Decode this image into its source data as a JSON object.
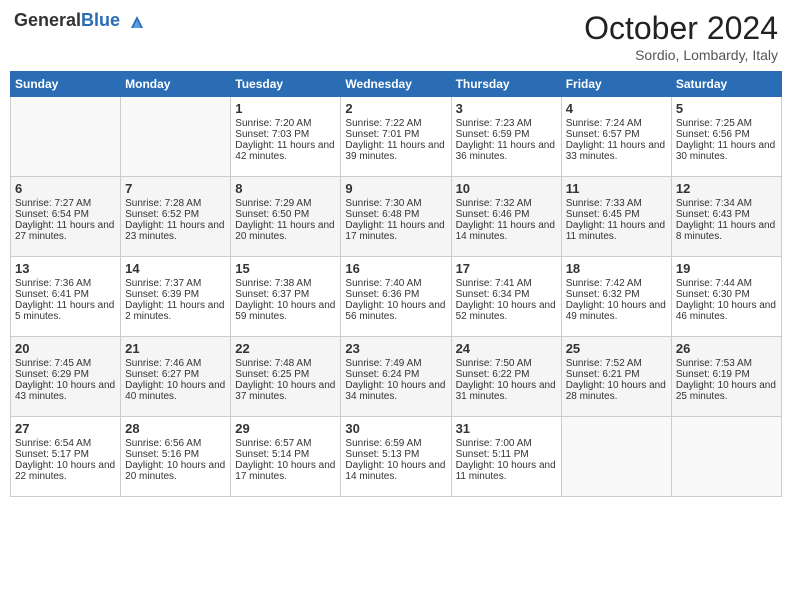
{
  "header": {
    "logo_general": "General",
    "logo_blue": "Blue",
    "month": "October 2024",
    "location": "Sordio, Lombardy, Italy"
  },
  "days_of_week": [
    "Sunday",
    "Monday",
    "Tuesday",
    "Wednesday",
    "Thursday",
    "Friday",
    "Saturday"
  ],
  "weeks": [
    [
      {
        "day": "",
        "sunrise": "",
        "sunset": "",
        "daylight": ""
      },
      {
        "day": "",
        "sunrise": "",
        "sunset": "",
        "daylight": ""
      },
      {
        "day": "1",
        "sunrise": "Sunrise: 7:20 AM",
        "sunset": "Sunset: 7:03 PM",
        "daylight": "Daylight: 11 hours and 42 minutes."
      },
      {
        "day": "2",
        "sunrise": "Sunrise: 7:22 AM",
        "sunset": "Sunset: 7:01 PM",
        "daylight": "Daylight: 11 hours and 39 minutes."
      },
      {
        "day": "3",
        "sunrise": "Sunrise: 7:23 AM",
        "sunset": "Sunset: 6:59 PM",
        "daylight": "Daylight: 11 hours and 36 minutes."
      },
      {
        "day": "4",
        "sunrise": "Sunrise: 7:24 AM",
        "sunset": "Sunset: 6:57 PM",
        "daylight": "Daylight: 11 hours and 33 minutes."
      },
      {
        "day": "5",
        "sunrise": "Sunrise: 7:25 AM",
        "sunset": "Sunset: 6:56 PM",
        "daylight": "Daylight: 11 hours and 30 minutes."
      }
    ],
    [
      {
        "day": "6",
        "sunrise": "Sunrise: 7:27 AM",
        "sunset": "Sunset: 6:54 PM",
        "daylight": "Daylight: 11 hours and 27 minutes."
      },
      {
        "day": "7",
        "sunrise": "Sunrise: 7:28 AM",
        "sunset": "Sunset: 6:52 PM",
        "daylight": "Daylight: 11 hours and 23 minutes."
      },
      {
        "day": "8",
        "sunrise": "Sunrise: 7:29 AM",
        "sunset": "Sunset: 6:50 PM",
        "daylight": "Daylight: 11 hours and 20 minutes."
      },
      {
        "day": "9",
        "sunrise": "Sunrise: 7:30 AM",
        "sunset": "Sunset: 6:48 PM",
        "daylight": "Daylight: 11 hours and 17 minutes."
      },
      {
        "day": "10",
        "sunrise": "Sunrise: 7:32 AM",
        "sunset": "Sunset: 6:46 PM",
        "daylight": "Daylight: 11 hours and 14 minutes."
      },
      {
        "day": "11",
        "sunrise": "Sunrise: 7:33 AM",
        "sunset": "Sunset: 6:45 PM",
        "daylight": "Daylight: 11 hours and 11 minutes."
      },
      {
        "day": "12",
        "sunrise": "Sunrise: 7:34 AM",
        "sunset": "Sunset: 6:43 PM",
        "daylight": "Daylight: 11 hours and 8 minutes."
      }
    ],
    [
      {
        "day": "13",
        "sunrise": "Sunrise: 7:36 AM",
        "sunset": "Sunset: 6:41 PM",
        "daylight": "Daylight: 11 hours and 5 minutes."
      },
      {
        "day": "14",
        "sunrise": "Sunrise: 7:37 AM",
        "sunset": "Sunset: 6:39 PM",
        "daylight": "Daylight: 11 hours and 2 minutes."
      },
      {
        "day": "15",
        "sunrise": "Sunrise: 7:38 AM",
        "sunset": "Sunset: 6:37 PM",
        "daylight": "Daylight: 10 hours and 59 minutes."
      },
      {
        "day": "16",
        "sunrise": "Sunrise: 7:40 AM",
        "sunset": "Sunset: 6:36 PM",
        "daylight": "Daylight: 10 hours and 56 minutes."
      },
      {
        "day": "17",
        "sunrise": "Sunrise: 7:41 AM",
        "sunset": "Sunset: 6:34 PM",
        "daylight": "Daylight: 10 hours and 52 minutes."
      },
      {
        "day": "18",
        "sunrise": "Sunrise: 7:42 AM",
        "sunset": "Sunset: 6:32 PM",
        "daylight": "Daylight: 10 hours and 49 minutes."
      },
      {
        "day": "19",
        "sunrise": "Sunrise: 7:44 AM",
        "sunset": "Sunset: 6:30 PM",
        "daylight": "Daylight: 10 hours and 46 minutes."
      }
    ],
    [
      {
        "day": "20",
        "sunrise": "Sunrise: 7:45 AM",
        "sunset": "Sunset: 6:29 PM",
        "daylight": "Daylight: 10 hours and 43 minutes."
      },
      {
        "day": "21",
        "sunrise": "Sunrise: 7:46 AM",
        "sunset": "Sunset: 6:27 PM",
        "daylight": "Daylight: 10 hours and 40 minutes."
      },
      {
        "day": "22",
        "sunrise": "Sunrise: 7:48 AM",
        "sunset": "Sunset: 6:25 PM",
        "daylight": "Daylight: 10 hours and 37 minutes."
      },
      {
        "day": "23",
        "sunrise": "Sunrise: 7:49 AM",
        "sunset": "Sunset: 6:24 PM",
        "daylight": "Daylight: 10 hours and 34 minutes."
      },
      {
        "day": "24",
        "sunrise": "Sunrise: 7:50 AM",
        "sunset": "Sunset: 6:22 PM",
        "daylight": "Daylight: 10 hours and 31 minutes."
      },
      {
        "day": "25",
        "sunrise": "Sunrise: 7:52 AM",
        "sunset": "Sunset: 6:21 PM",
        "daylight": "Daylight: 10 hours and 28 minutes."
      },
      {
        "day": "26",
        "sunrise": "Sunrise: 7:53 AM",
        "sunset": "Sunset: 6:19 PM",
        "daylight": "Daylight: 10 hours and 25 minutes."
      }
    ],
    [
      {
        "day": "27",
        "sunrise": "Sunrise: 6:54 AM",
        "sunset": "Sunset: 5:17 PM",
        "daylight": "Daylight: 10 hours and 22 minutes."
      },
      {
        "day": "28",
        "sunrise": "Sunrise: 6:56 AM",
        "sunset": "Sunset: 5:16 PM",
        "daylight": "Daylight: 10 hours and 20 minutes."
      },
      {
        "day": "29",
        "sunrise": "Sunrise: 6:57 AM",
        "sunset": "Sunset: 5:14 PM",
        "daylight": "Daylight: 10 hours and 17 minutes."
      },
      {
        "day": "30",
        "sunrise": "Sunrise: 6:59 AM",
        "sunset": "Sunset: 5:13 PM",
        "daylight": "Daylight: 10 hours and 14 minutes."
      },
      {
        "day": "31",
        "sunrise": "Sunrise: 7:00 AM",
        "sunset": "Sunset: 5:11 PM",
        "daylight": "Daylight: 10 hours and 11 minutes."
      },
      {
        "day": "",
        "sunrise": "",
        "sunset": "",
        "daylight": ""
      },
      {
        "day": "",
        "sunrise": "",
        "sunset": "",
        "daylight": ""
      }
    ]
  ]
}
